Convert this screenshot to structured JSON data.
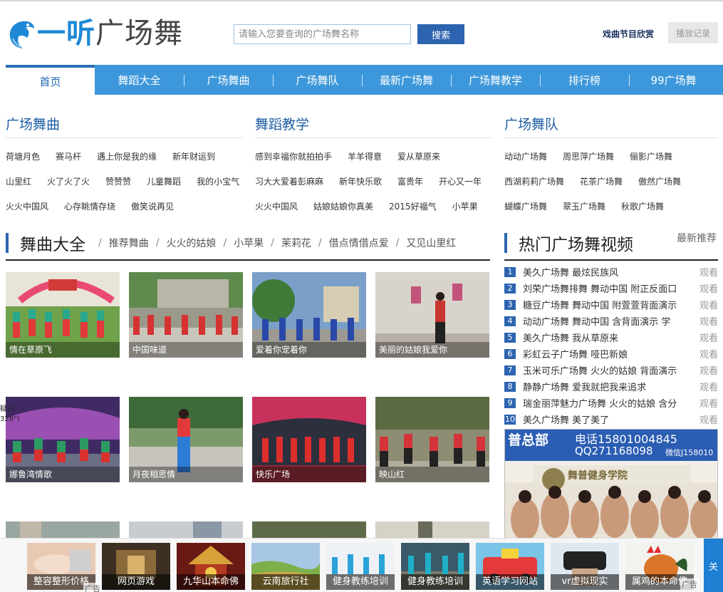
{
  "header": {
    "logo_brand": "一听",
    "logo_name": "广场舞",
    "search_placeholder": "请输入您要查询的广场舞名称",
    "search_button": "搜索",
    "opera_link": "戏曲节目欣赏",
    "history_button": "播放记录"
  },
  "nav": {
    "items": [
      "首页",
      "舞蹈大全",
      "广场舞曲",
      "广场舞队",
      "最新广场舞",
      "广场舞教学",
      "排行榜",
      "99广场舞"
    ]
  },
  "columns": [
    {
      "title": "广场舞曲",
      "rows": [
        [
          "荷塘月色",
          "赛马杆",
          "遇上你是我的缘",
          "新年财运到"
        ],
        [
          "山里红",
          "火了火了火",
          "赞赞赞",
          "儿童舞蹈",
          "我的小宝气"
        ],
        [
          "火火中国风",
          "心存眺情存烧",
          "傲笑说再见"
        ]
      ]
    },
    {
      "title": "舞蹈教学",
      "rows": [
        [
          "感到幸福你就拍拍手",
          "羊羊得意",
          "爱从草原来"
        ],
        [
          "习大大爱着彭麻麻",
          "新年快乐歌",
          "富贵年",
          "开心又一年"
        ],
        [
          "火火中国风",
          "姑娘姑娘你真美",
          "2015好福气",
          "小苹果"
        ]
      ]
    },
    {
      "title": "广场舞队",
      "rows": [
        [
          "动动广场舞",
          "周思萍广场舞",
          "俪影广场舞"
        ],
        [
          "西湖莉莉广场舞",
          "花茶广场舞",
          "傲然广场舞"
        ],
        [
          "蝴蝶广场舞",
          "翠玉广场舞",
          "秋歌广场舞"
        ]
      ]
    }
  ],
  "section": {
    "title": "舞曲大全",
    "links": [
      "推荐舞曲",
      "火火的姑娘",
      "小苹果",
      "茉莉花",
      "借点情借点爱",
      "又见山里红"
    ]
  },
  "videos": [
    {
      "title": "情在草原飞"
    },
    {
      "title": "中国味道"
    },
    {
      "title": "爱着你宠着你"
    },
    {
      "title": "美丽的姑娘我爱你"
    },
    {
      "title": "娜鲁湾情歌"
    },
    {
      "title": "月夜相思情"
    },
    {
      "title": "快乐广场"
    },
    {
      "title": "映山红"
    }
  ],
  "hot": {
    "title": "热门广场舞视频",
    "latest_link": "最新推荐",
    "watch_label": "观看",
    "items": [
      {
        "num": "1",
        "text": "美久广场舞 最炫民族风"
      },
      {
        "num": "2",
        "text": "刘荣广场舞排舞 舞动中国 附正反面口"
      },
      {
        "num": "3",
        "text": "糖豆广场舞 舞动中国 附萱萱背面演示"
      },
      {
        "num": "4",
        "text": "动动广场舞 舞动中国 含背面演示 学"
      },
      {
        "num": "5",
        "text": "美久广场舞 我从草原来"
      },
      {
        "num": "6",
        "text": "彩虹云子广场舞 哑巴新娘"
      },
      {
        "num": "7",
        "text": "玉米可乐广场舞 火火的姑娘 背面演示"
      },
      {
        "num": "8",
        "text": "静静广场舞 爱我就把我来追求"
      },
      {
        "num": "9",
        "text": "瑞金丽萍魅力广场舞 火火的姑娘 含分"
      },
      {
        "num": "10",
        "text": "美久广场舞 美了美了"
      }
    ]
  },
  "ad_right": {
    "line1": "普总部",
    "phone": "电话15801004845",
    "qq": "QQ271168098",
    "wechat": "微信J158010",
    "school": "舞普健身学院"
  },
  "bottom": {
    "items": [
      "整容整形价格",
      "网页游戏",
      "九华山本命佛",
      "云南旅行社",
      "健身教练培训",
      "健身教练培训",
      "英语学习网站",
      "vr虚拟现实",
      "属鸡的本命佛"
    ],
    "close_label": "关",
    "ad_label_left": "广告",
    "ad_label_right": "广告"
  },
  "left_float": {
    "line1": "疑]:(",
    "line2": "328\")"
  }
}
